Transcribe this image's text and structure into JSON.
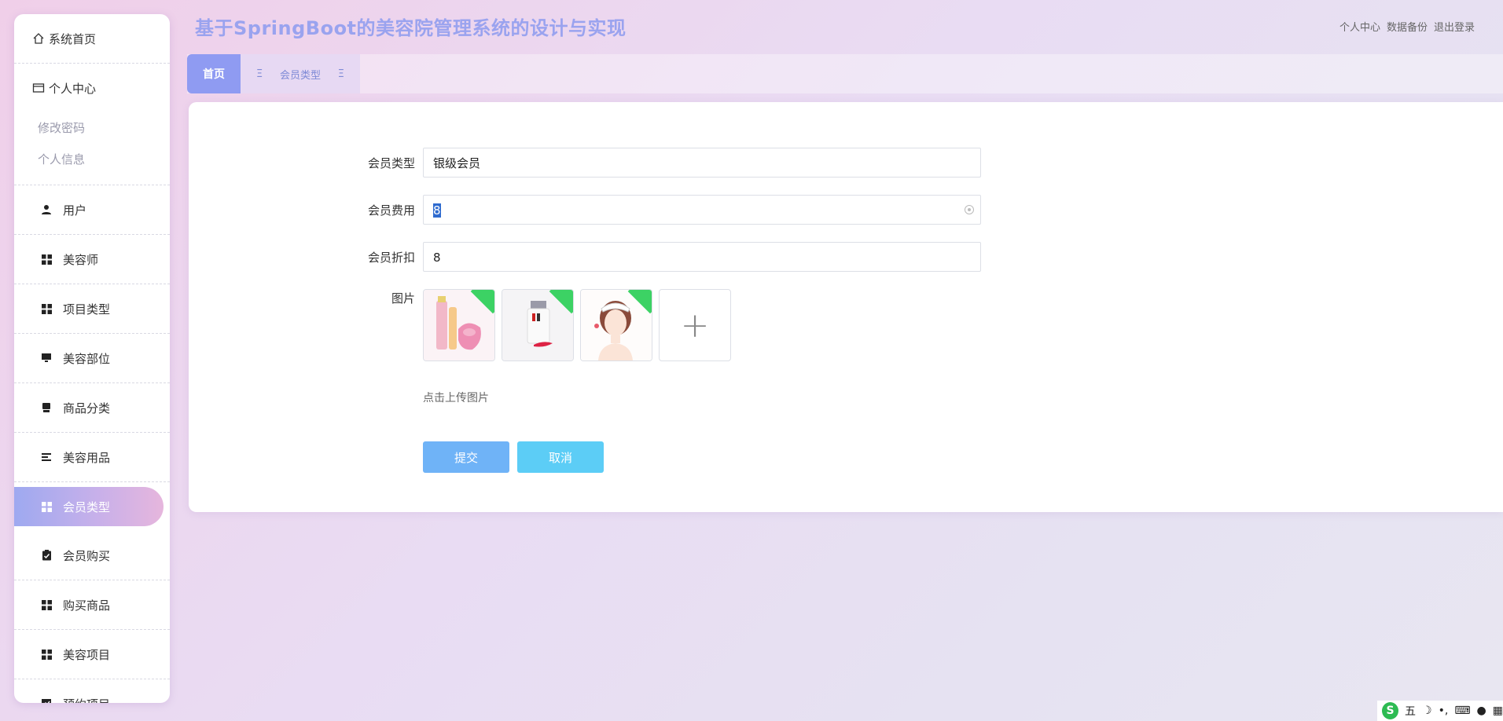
{
  "header": {
    "app_title": "基于SpringBoot的美容院管理系统的设计与实现",
    "links": [
      "个人中心",
      "数据备份",
      "退出登录"
    ]
  },
  "sidebar": {
    "home": "系统首页",
    "personal_center": "个人中心",
    "personal_sub": [
      "修改密码",
      "个人信息"
    ],
    "items": [
      {
        "label": "用户",
        "icon": "user-icon"
      },
      {
        "label": "美容师",
        "icon": "grid-icon"
      },
      {
        "label": "项目类型",
        "icon": "grid-icon"
      },
      {
        "label": "美容部位",
        "icon": "monitor-icon"
      },
      {
        "label": "商品分类",
        "icon": "printer-icon"
      },
      {
        "label": "美容用品",
        "icon": "list-icon"
      },
      {
        "label": "会员类型",
        "icon": "grid-icon",
        "active": true
      },
      {
        "label": "会员购买",
        "icon": "clipboard-check-icon"
      },
      {
        "label": "购买商品",
        "icon": "grid-icon"
      },
      {
        "label": "美容项目",
        "icon": "grid-icon"
      },
      {
        "label": "预约项目",
        "icon": "chart-icon"
      }
    ]
  },
  "tabs": {
    "home": "首页",
    "current": "会员类型",
    "glyph": "Ξ"
  },
  "form": {
    "member_type_label": "会员类型",
    "member_type_value": "银级会员",
    "fee_label": "会员费用",
    "fee_value": "8",
    "discount_label": "会员折扣",
    "discount_value": "8",
    "image_label": "图片",
    "upload_tip": "点击上传图片",
    "submit": "提交",
    "cancel": "取消"
  },
  "tray": {
    "ime": "五"
  },
  "colors": {
    "accent": "#8f9bf2",
    "title": "#9aa3ef",
    "submit": "#6fb3f7",
    "cancel": "#5ccdf6",
    "badge": "#3cd264"
  }
}
